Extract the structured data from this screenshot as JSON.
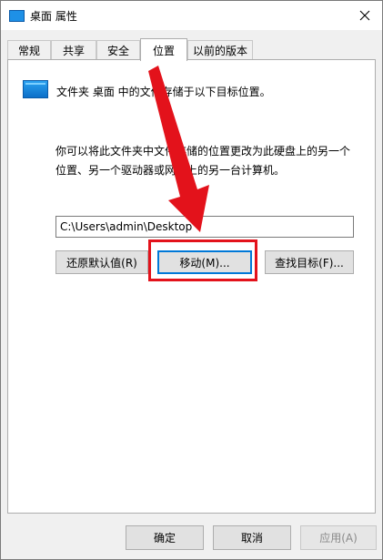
{
  "window": {
    "title": "桌面 属性"
  },
  "tabs": [
    {
      "label": "常规"
    },
    {
      "label": "共享"
    },
    {
      "label": "安全"
    },
    {
      "label": "位置"
    },
    {
      "label": "以前的版本"
    }
  ],
  "location": {
    "description": "文件夹 桌面 中的文件存储于以下目标位置。",
    "info_line1": "你可以将此文件夹中文件存储的位置更改为此硬盘上的另一个",
    "info_line2": "位置、另一个驱动器或网络上的另一台计算机。",
    "path_value": "C:\\Users\\admin\\Desktop",
    "restore_default_label": "还原默认值(R)",
    "move_label": "移动(M)...",
    "find_target_label": "查找目标(F)..."
  },
  "footer": {
    "ok_label": "确定",
    "cancel_label": "取消",
    "apply_label": "应用(A)"
  },
  "colors": {
    "annotation_red": "#e3121b",
    "focus_blue": "#0078d7",
    "folder_blue": "#1e90e6"
  },
  "icons": [
    "folder-icon",
    "close-icon",
    "red-arrow-annotation"
  ]
}
